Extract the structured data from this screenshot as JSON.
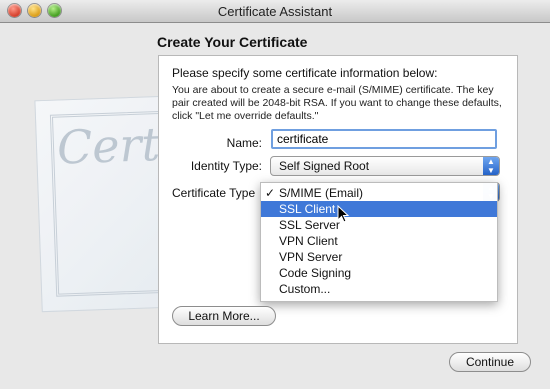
{
  "window": {
    "title": "Certificate Assistant"
  },
  "page": {
    "heading": "Create Your Certificate",
    "intro": "Please specify some certificate information below:",
    "description": "You are about to create a secure e-mail (S/MIME) certificate. The key pair created will be 2048-bit RSA. If you want to change these defaults, click \"Let me override defaults.\""
  },
  "form": {
    "name_label": "Name:",
    "name_value": "certificate",
    "identity_label": "Identity Type:",
    "identity_value": "Self Signed Root",
    "cert_type_label": "Certificate Type"
  },
  "menu": {
    "items": [
      {
        "label": "S/MIME (Email)",
        "checked": true
      },
      {
        "label": "SSL Client",
        "highlighted": true
      },
      {
        "label": "SSL Server"
      },
      {
        "label": "VPN Client"
      },
      {
        "label": "VPN Server"
      },
      {
        "label": "Code Signing"
      },
      {
        "label": "Custom..."
      }
    ]
  },
  "buttons": {
    "learn_more": "Learn More...",
    "continue": "Continue"
  },
  "background": {
    "cert_word": "Certif"
  },
  "icons": {
    "traffic_close": "close-icon",
    "traffic_min": "minimize-icon",
    "traffic_zoom": "zoom-icon",
    "cursor": "cursor-icon"
  },
  "colors": {
    "accent": "#3f78d8",
    "focus_ring": "#6f9fe0"
  }
}
